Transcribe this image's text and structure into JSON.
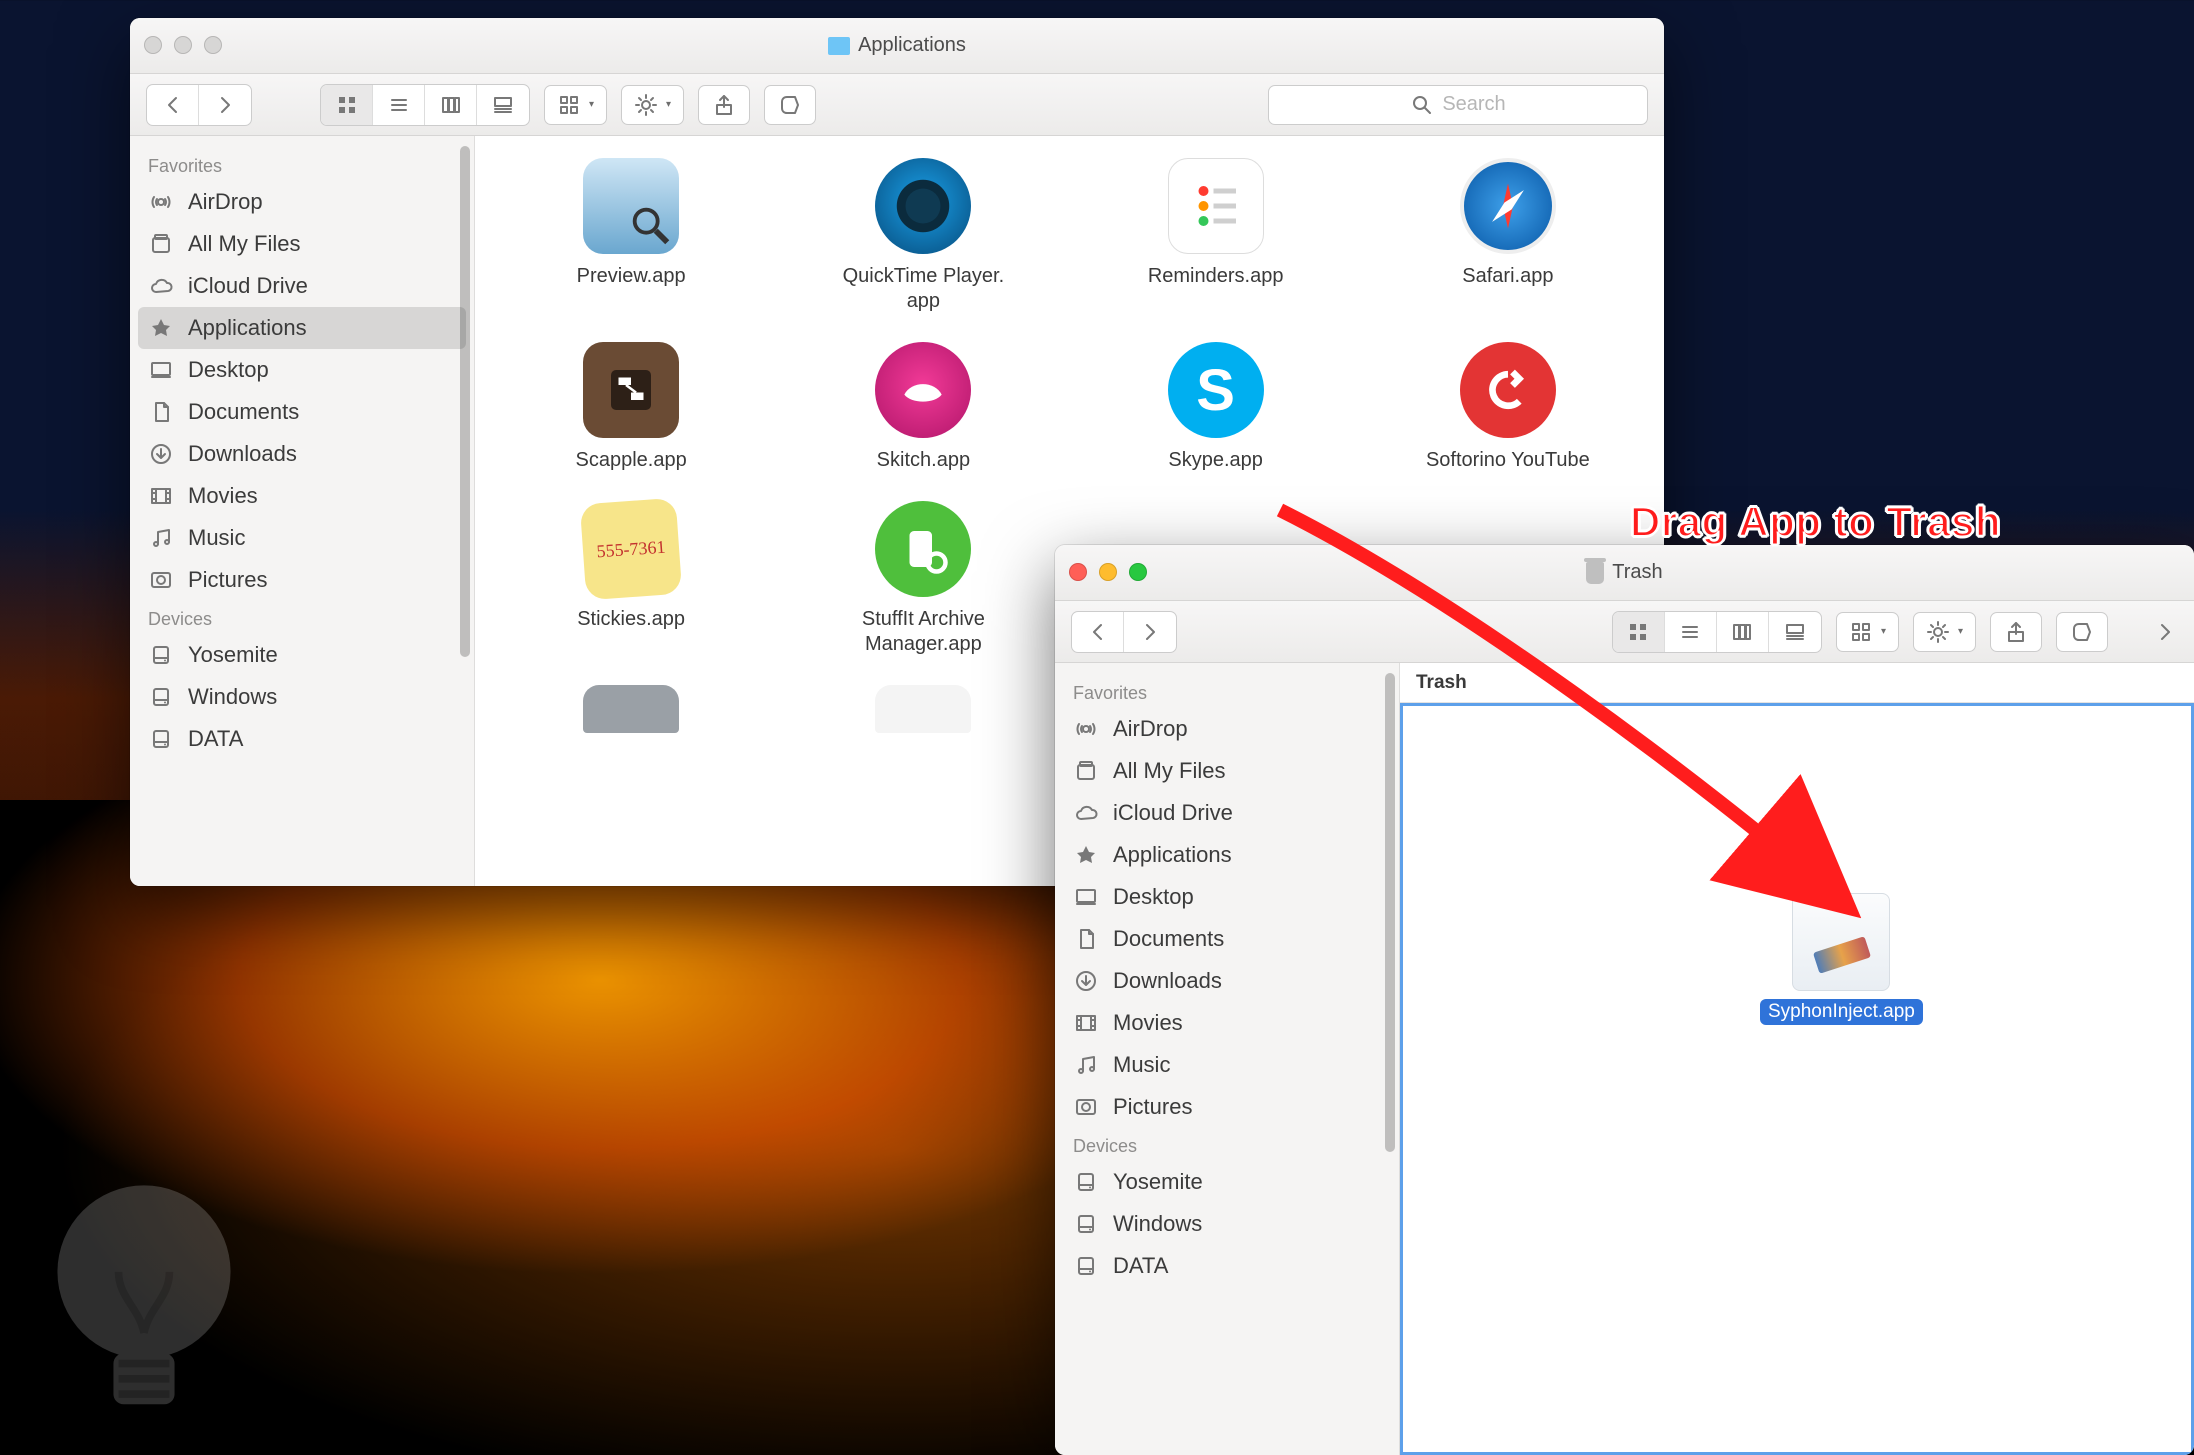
{
  "annotation": {
    "text": "Drag App to Trash"
  },
  "win_apps": {
    "title": "Applications",
    "search_placeholder": "Search",
    "sidebar": {
      "favorites_header": "Favorites",
      "devices_header": "Devices",
      "favorites": [
        {
          "icon": "airdrop",
          "label": "AirDrop"
        },
        {
          "icon": "all-my-files",
          "label": "All My Files"
        },
        {
          "icon": "icloud",
          "label": "iCloud Drive"
        },
        {
          "icon": "applications",
          "label": "Applications",
          "selected": true
        },
        {
          "icon": "desktop",
          "label": "Desktop"
        },
        {
          "icon": "documents",
          "label": "Documents"
        },
        {
          "icon": "downloads",
          "label": "Downloads"
        },
        {
          "icon": "movies",
          "label": "Movies"
        },
        {
          "icon": "music",
          "label": "Music"
        },
        {
          "icon": "pictures",
          "label": "Pictures"
        }
      ],
      "devices": [
        {
          "icon": "disk",
          "label": "Yosemite"
        },
        {
          "icon": "disk",
          "label": "Windows"
        },
        {
          "icon": "disk",
          "label": "DATA"
        }
      ]
    },
    "apps": [
      {
        "name": "Preview.app"
      },
      {
        "name": "QuickTime Player.app"
      },
      {
        "name": "Reminders.app"
      },
      {
        "name": "Safari.app"
      },
      {
        "name": "Scapple.app"
      },
      {
        "name": "Skitch.app"
      },
      {
        "name": "Skype.app"
      },
      {
        "name": "Softorino YouTube"
      },
      {
        "name": "Stickies.app"
      },
      {
        "name": "StuffIt Archive Manager.app"
      }
    ]
  },
  "win_trash": {
    "title": "Trash",
    "path_label": "Trash",
    "sidebar": {
      "favorites_header": "Favorites",
      "devices_header": "Devices",
      "favorites": [
        {
          "icon": "airdrop",
          "label": "AirDrop"
        },
        {
          "icon": "all-my-files",
          "label": "All My Files"
        },
        {
          "icon": "icloud",
          "label": "iCloud Drive"
        },
        {
          "icon": "applications",
          "label": "Applications"
        },
        {
          "icon": "desktop",
          "label": "Desktop"
        },
        {
          "icon": "documents",
          "label": "Documents"
        },
        {
          "icon": "downloads",
          "label": "Downloads"
        },
        {
          "icon": "movies",
          "label": "Movies"
        },
        {
          "icon": "music",
          "label": "Music"
        },
        {
          "icon": "pictures",
          "label": "Pictures"
        }
      ],
      "devices": [
        {
          "icon": "disk",
          "label": "Yosemite"
        },
        {
          "icon": "disk",
          "label": "Windows"
        },
        {
          "icon": "disk",
          "label": "DATA"
        }
      ]
    },
    "items": [
      {
        "name": "SyphonInject.app",
        "selected": true
      }
    ]
  },
  "icon_colors": {
    "Preview.app": "#eaeaea",
    "QuickTime Player.app": "#1b6fb6",
    "Reminders.app": "#ffffff",
    "Safari.app": "#ffffff",
    "Scapple.app": "#6a4b34",
    "Skitch.app": "#e01c7a",
    "Skype.app": "#00aff0",
    "Softorino YouTube": "#e33434",
    "Stickies.app": "#f7e58a",
    "StuffIt Archive Manager.app": "#4fbf3c"
  }
}
